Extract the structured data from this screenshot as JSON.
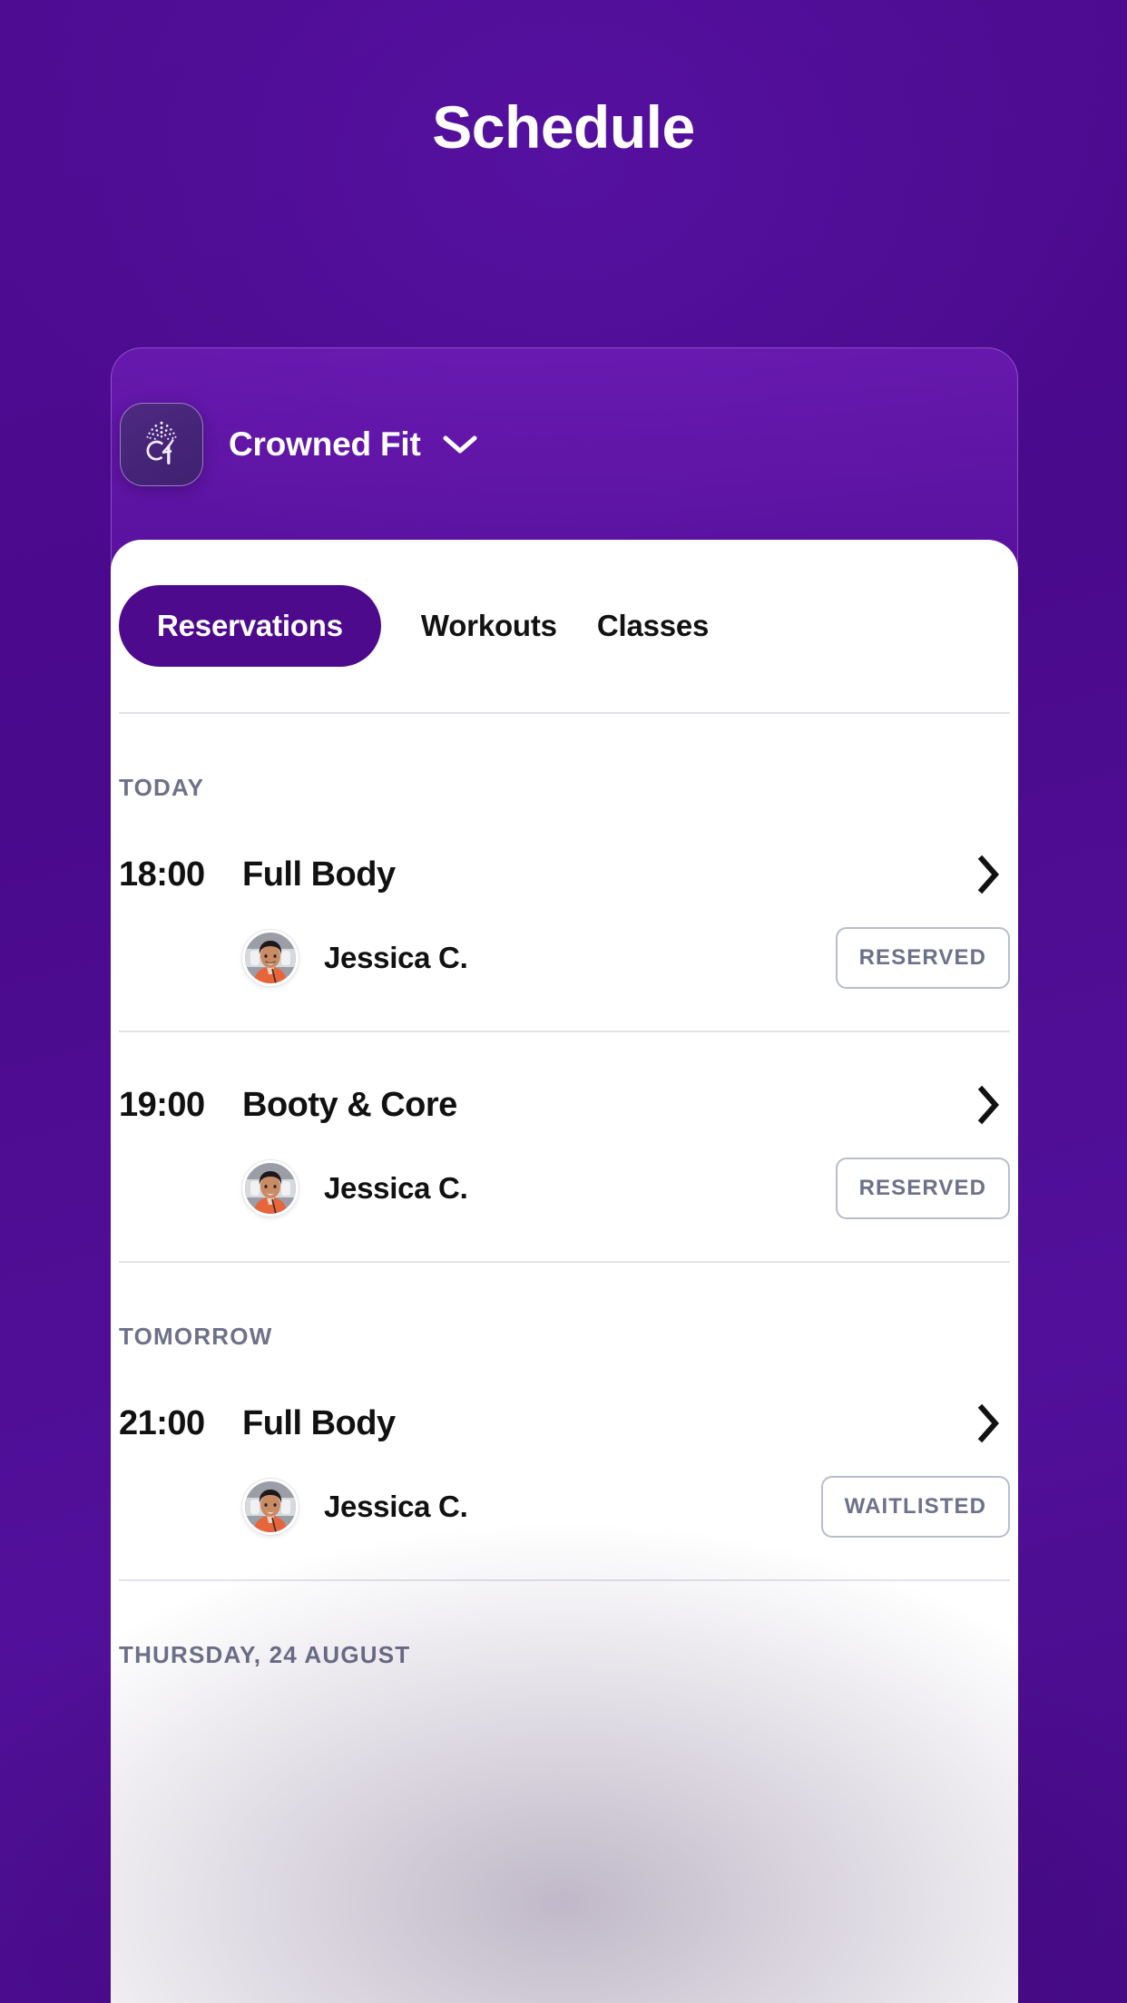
{
  "header": {
    "title": "Schedule"
  },
  "brand": {
    "name": "Crowned Fit",
    "logo_icon": "crowned-fit-cf-monogram-icon",
    "dropdown_icon": "chevron-down-icon"
  },
  "tabs": [
    {
      "label": "Reservations",
      "active": true
    },
    {
      "label": "Workouts",
      "active": false
    },
    {
      "label": "Classes",
      "active": false
    }
  ],
  "sections": [
    {
      "label": "TODAY",
      "items": [
        {
          "time": "18:00",
          "name": "Full Body",
          "chevron_icon": "chevron-right-icon",
          "trainer": "Jessica C.",
          "avatar_icon": "trainer-avatar-photo",
          "status": "RESERVED"
        },
        {
          "time": "19:00",
          "name": "Booty & Core",
          "chevron_icon": "chevron-right-icon",
          "trainer": "Jessica C.",
          "avatar_icon": "trainer-avatar-photo",
          "status": "RESERVED"
        }
      ]
    },
    {
      "label": "TOMORROW",
      "items": [
        {
          "time": "21:00",
          "name": "Full Body",
          "chevron_icon": "chevron-right-icon",
          "trainer": "Jessica C.",
          "avatar_icon": "trainer-avatar-photo",
          "status": "WAITLISTED"
        }
      ]
    },
    {
      "label": "THURSDAY, 24 AUGUST",
      "items": []
    }
  ],
  "colors": {
    "background_purple": "#4a0a8c",
    "accent_purple": "#4e0a8c",
    "panel_white": "#ffffff",
    "muted_text": "#6d7189",
    "rule": "#e3e3e8",
    "badge_border": "#b9bdcc"
  }
}
